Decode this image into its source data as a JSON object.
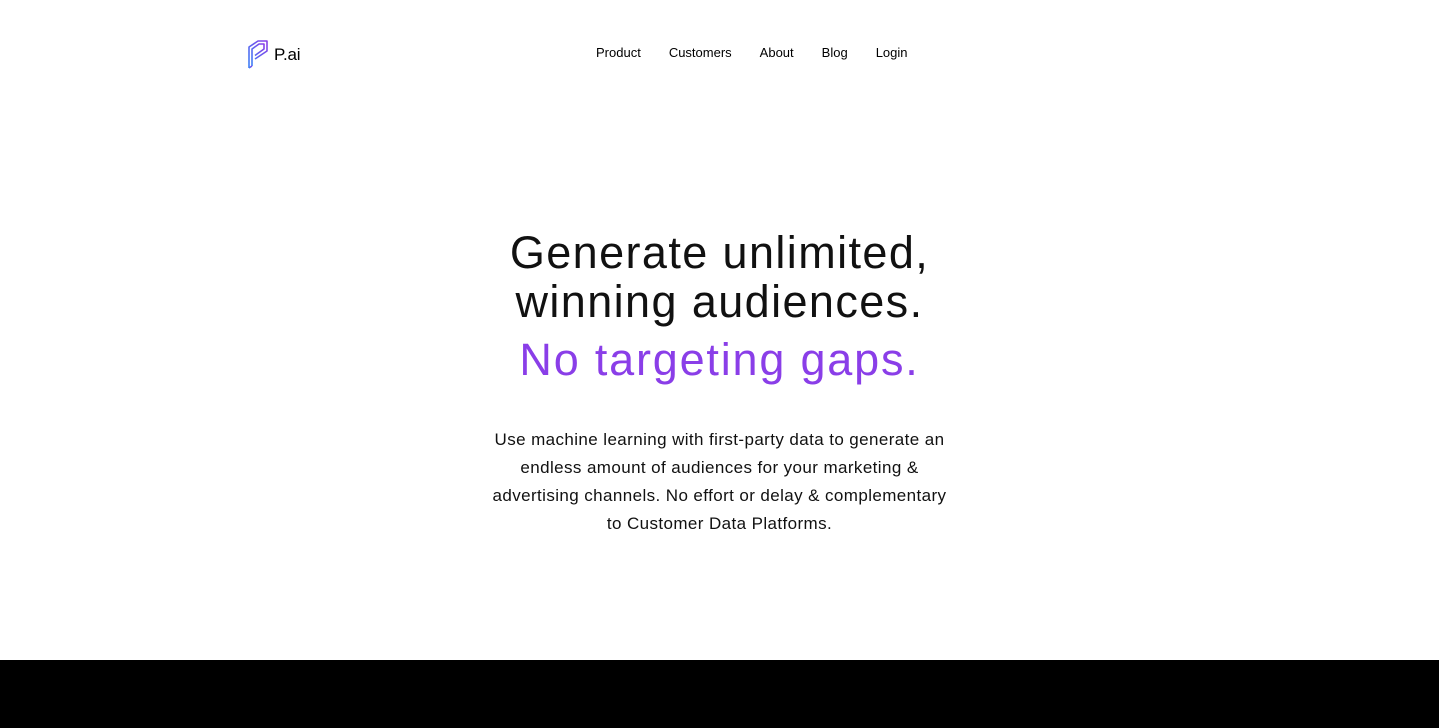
{
  "brand": {
    "name": "P.ai",
    "logo_icon": "pai-logo-icon",
    "logo_gradient": [
      "#3b82f6",
      "#8a3ee8"
    ]
  },
  "nav": {
    "items": [
      {
        "label": "Product"
      },
      {
        "label": "Customers"
      },
      {
        "label": "About"
      },
      {
        "label": "Blog"
      },
      {
        "label": "Login"
      }
    ]
  },
  "hero": {
    "title_line1": "Generate unlimited,",
    "title_line2": "winning audiences.",
    "accent": "No targeting gaps.",
    "accent_color": "#8a3ee8",
    "description": "Use machine learning with first-party data to generate an endless amount of audiences for your marketing & advertising channels. No effort or delay & complementary to Customer Data Platforms."
  },
  "colors": {
    "background": "#ffffff",
    "text": "#000000",
    "bottom_band": "#000000"
  }
}
